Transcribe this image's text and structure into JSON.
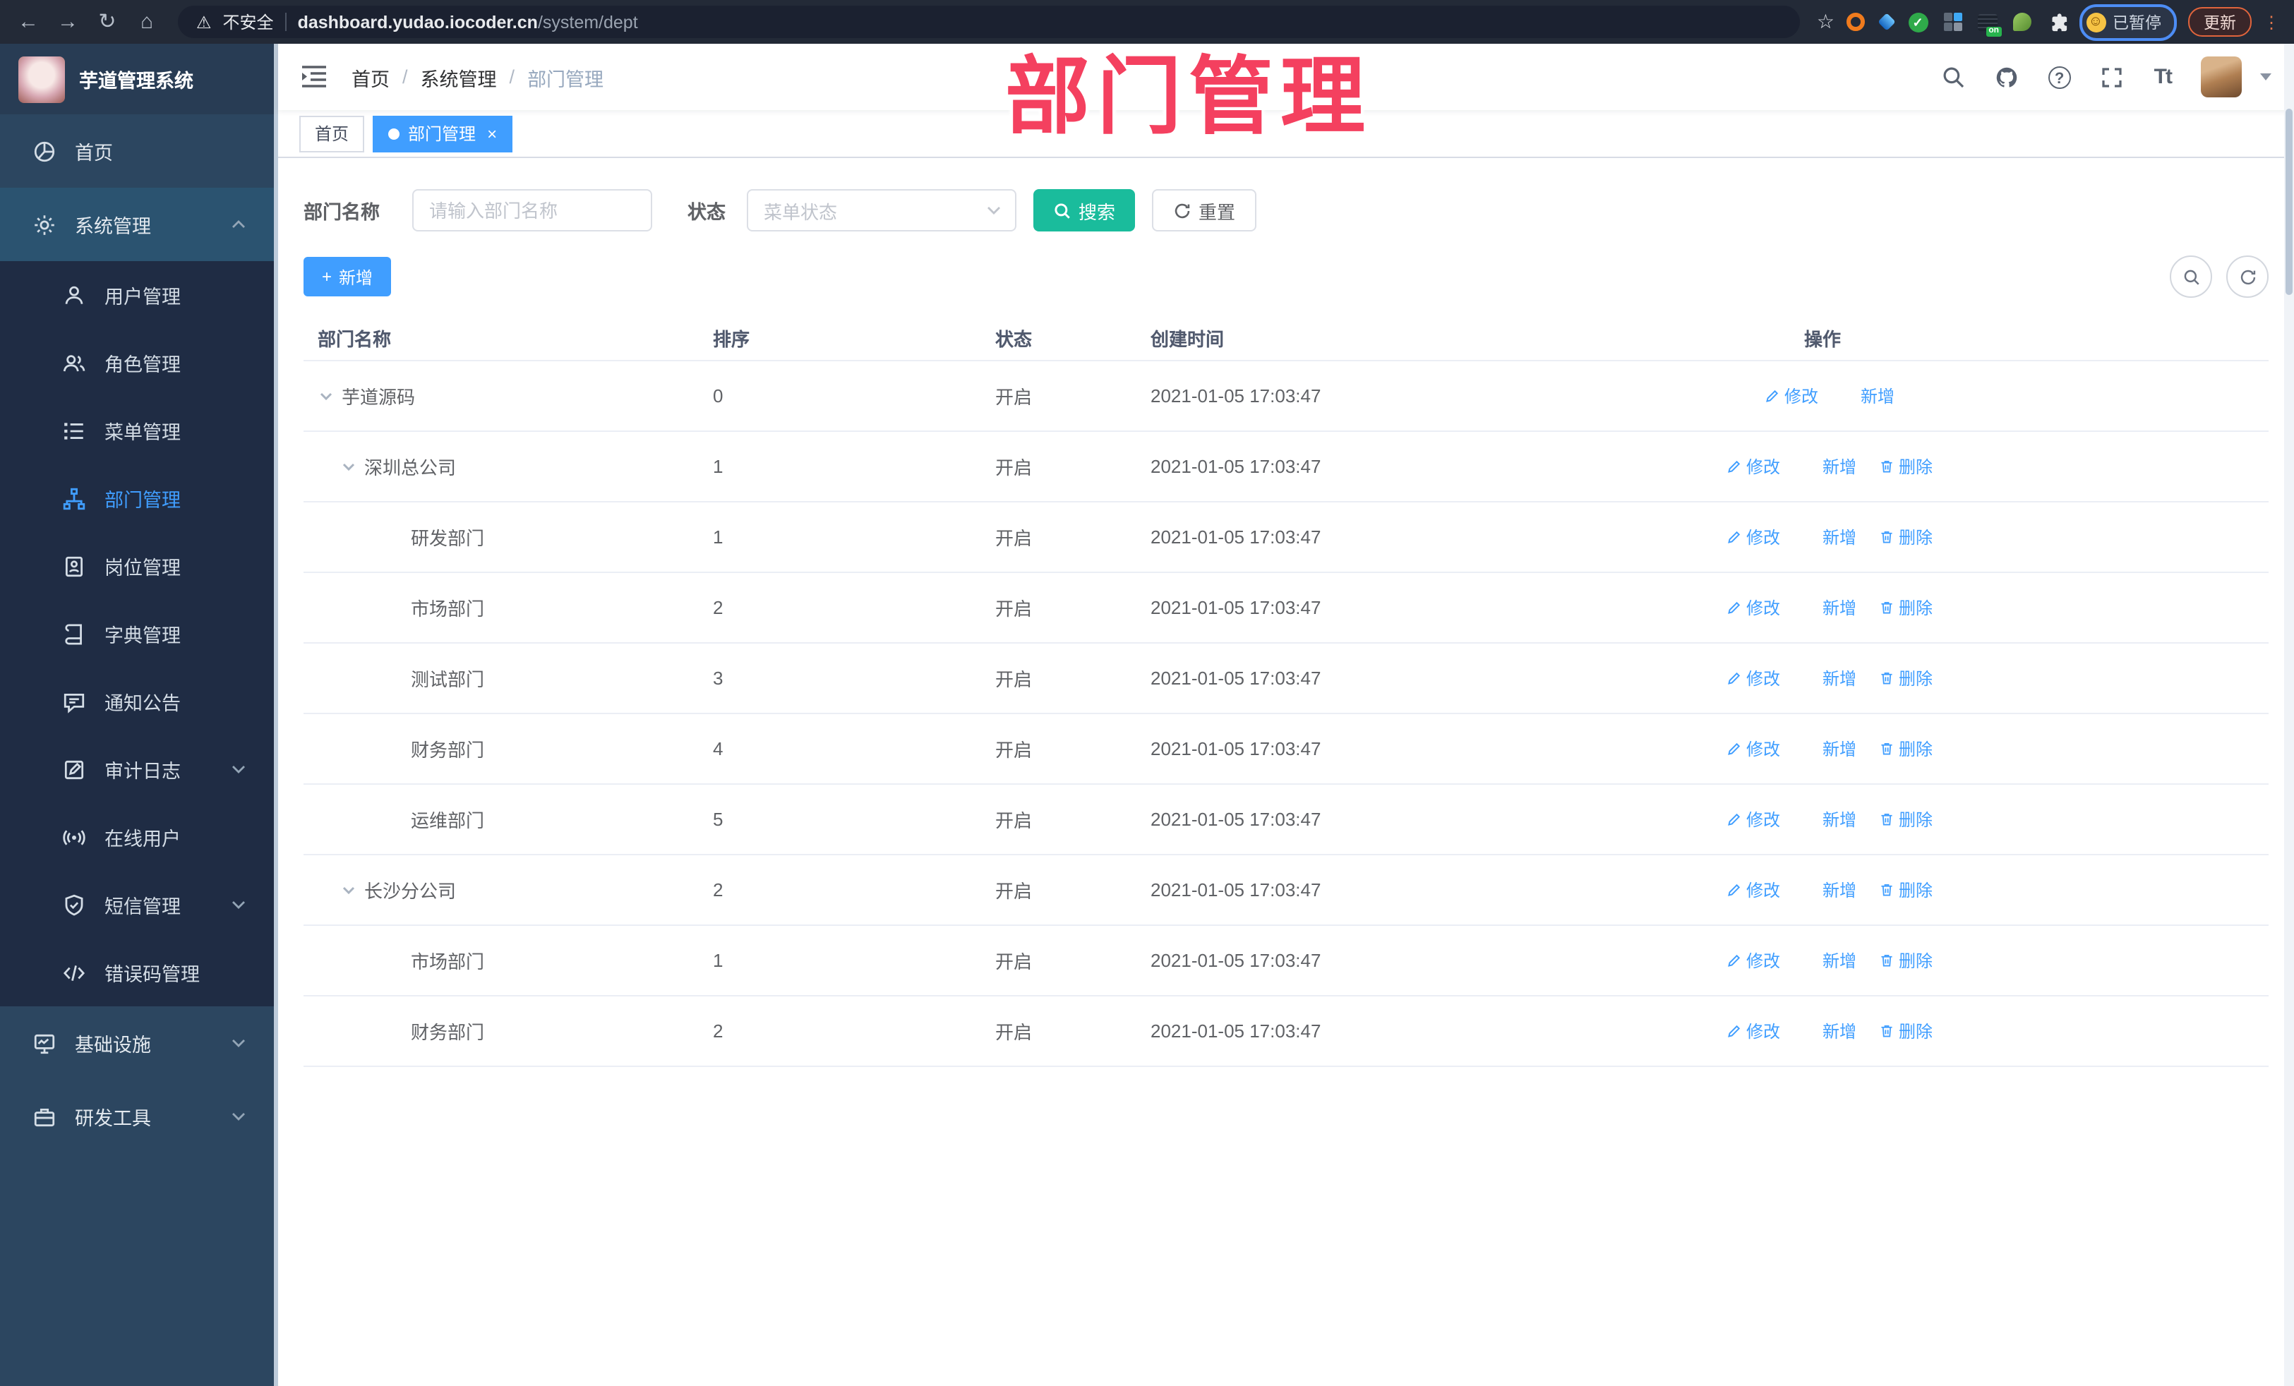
{
  "browser": {
    "security_text": "不安全",
    "url_host": "dashboard.yudao.iocoder.cn",
    "url_path": "/system/dept",
    "profile_chip_label": "已暂停",
    "update_button_label": "更新"
  },
  "watermark_text": "部门管理",
  "sidebar": {
    "title": "芋道管理系统",
    "items": [
      {
        "label": "首页",
        "icon": "dashboard-icon",
        "type": "top"
      },
      {
        "label": "系统管理",
        "icon": "gear-icon",
        "type": "top",
        "chevron": "up",
        "highlight": true
      },
      {
        "label": "用户管理",
        "icon": "user-icon",
        "type": "sub"
      },
      {
        "label": "角色管理",
        "icon": "users-icon",
        "type": "sub"
      },
      {
        "label": "菜单管理",
        "icon": "menu-list-icon",
        "type": "sub"
      },
      {
        "label": "部门管理",
        "icon": "org-tree-icon",
        "type": "sub",
        "active": true
      },
      {
        "label": "岗位管理",
        "icon": "badge-icon",
        "type": "sub"
      },
      {
        "label": "字典管理",
        "icon": "dict-book-icon",
        "type": "sub"
      },
      {
        "label": "通知公告",
        "icon": "announcement-icon",
        "type": "sub"
      },
      {
        "label": "审计日志",
        "icon": "audit-log-icon",
        "type": "sub",
        "chevron": "down"
      },
      {
        "label": "在线用户",
        "icon": "online-user-icon",
        "type": "sub"
      },
      {
        "label": "短信管理",
        "icon": "sms-shield-icon",
        "type": "sub",
        "chevron": "down"
      },
      {
        "label": "错误码管理",
        "icon": "code-icon",
        "type": "sub"
      },
      {
        "label": "基础设施",
        "icon": "infra-monitor-icon",
        "type": "top",
        "chevron": "down"
      },
      {
        "label": "研发工具",
        "icon": "dev-tools-icon",
        "type": "top",
        "chevron": "down"
      }
    ]
  },
  "header": {
    "breadcrumb": [
      "首页",
      "系统管理",
      "部门管理"
    ]
  },
  "tabs": [
    {
      "label": "首页",
      "active": false
    },
    {
      "label": "部门管理",
      "active": true,
      "closable": true
    }
  ],
  "filters": {
    "name_label": "部门名称",
    "name_placeholder": "请输入部门名称",
    "status_label": "状态",
    "status_placeholder": "菜单状态",
    "search_label": "搜索",
    "reset_label": "重置"
  },
  "toolbar": {
    "add_label": "新增"
  },
  "table": {
    "columns": [
      "部门名称",
      "排序",
      "状态",
      "创建时间",
      "操作"
    ],
    "action_labels": {
      "edit": "修改",
      "add": "新增",
      "delete": "删除"
    },
    "rows": [
      {
        "name": "芋道源码",
        "level": 0,
        "expandable": true,
        "sort": "0",
        "status": "开启",
        "created": "2021-01-05 17:03:47",
        "actions": [
          "edit",
          "add"
        ]
      },
      {
        "name": "深圳总公司",
        "level": 1,
        "expandable": true,
        "sort": "1",
        "status": "开启",
        "created": "2021-01-05 17:03:47",
        "actions": [
          "edit",
          "add",
          "delete"
        ]
      },
      {
        "name": "研发部门",
        "level": 2,
        "expandable": false,
        "sort": "1",
        "status": "开启",
        "created": "2021-01-05 17:03:47",
        "actions": [
          "edit",
          "add",
          "delete"
        ]
      },
      {
        "name": "市场部门",
        "level": 2,
        "expandable": false,
        "sort": "2",
        "status": "开启",
        "created": "2021-01-05 17:03:47",
        "actions": [
          "edit",
          "add",
          "delete"
        ]
      },
      {
        "name": "测试部门",
        "level": 2,
        "expandable": false,
        "sort": "3",
        "status": "开启",
        "created": "2021-01-05 17:03:47",
        "actions": [
          "edit",
          "add",
          "delete"
        ]
      },
      {
        "name": "财务部门",
        "level": 2,
        "expandable": false,
        "sort": "4",
        "status": "开启",
        "created": "2021-01-05 17:03:47",
        "actions": [
          "edit",
          "add",
          "delete"
        ]
      },
      {
        "name": "运维部门",
        "level": 2,
        "expandable": false,
        "sort": "5",
        "status": "开启",
        "created": "2021-01-05 17:03:47",
        "actions": [
          "edit",
          "add",
          "delete"
        ]
      },
      {
        "name": "长沙分公司",
        "level": 1,
        "expandable": true,
        "sort": "2",
        "status": "开启",
        "created": "2021-01-05 17:03:47",
        "actions": [
          "edit",
          "add",
          "delete"
        ]
      },
      {
        "name": "市场部门",
        "level": 2,
        "expandable": false,
        "sort": "1",
        "status": "开启",
        "created": "2021-01-05 17:03:47",
        "actions": [
          "edit",
          "add",
          "delete"
        ]
      },
      {
        "name": "财务部门",
        "level": 2,
        "expandable": false,
        "sort": "2",
        "status": "开启",
        "created": "2021-01-05 17:03:47",
        "actions": [
          "edit",
          "add",
          "delete"
        ]
      }
    ]
  },
  "colors": {
    "accent_blue": "#409eff",
    "search_teal": "#1abc9c",
    "watermark_pink": "#f4405f",
    "sidebar_bg": "#2c4660",
    "sidebar_submenu_bg": "#1f2c44",
    "status_open": "开启"
  }
}
